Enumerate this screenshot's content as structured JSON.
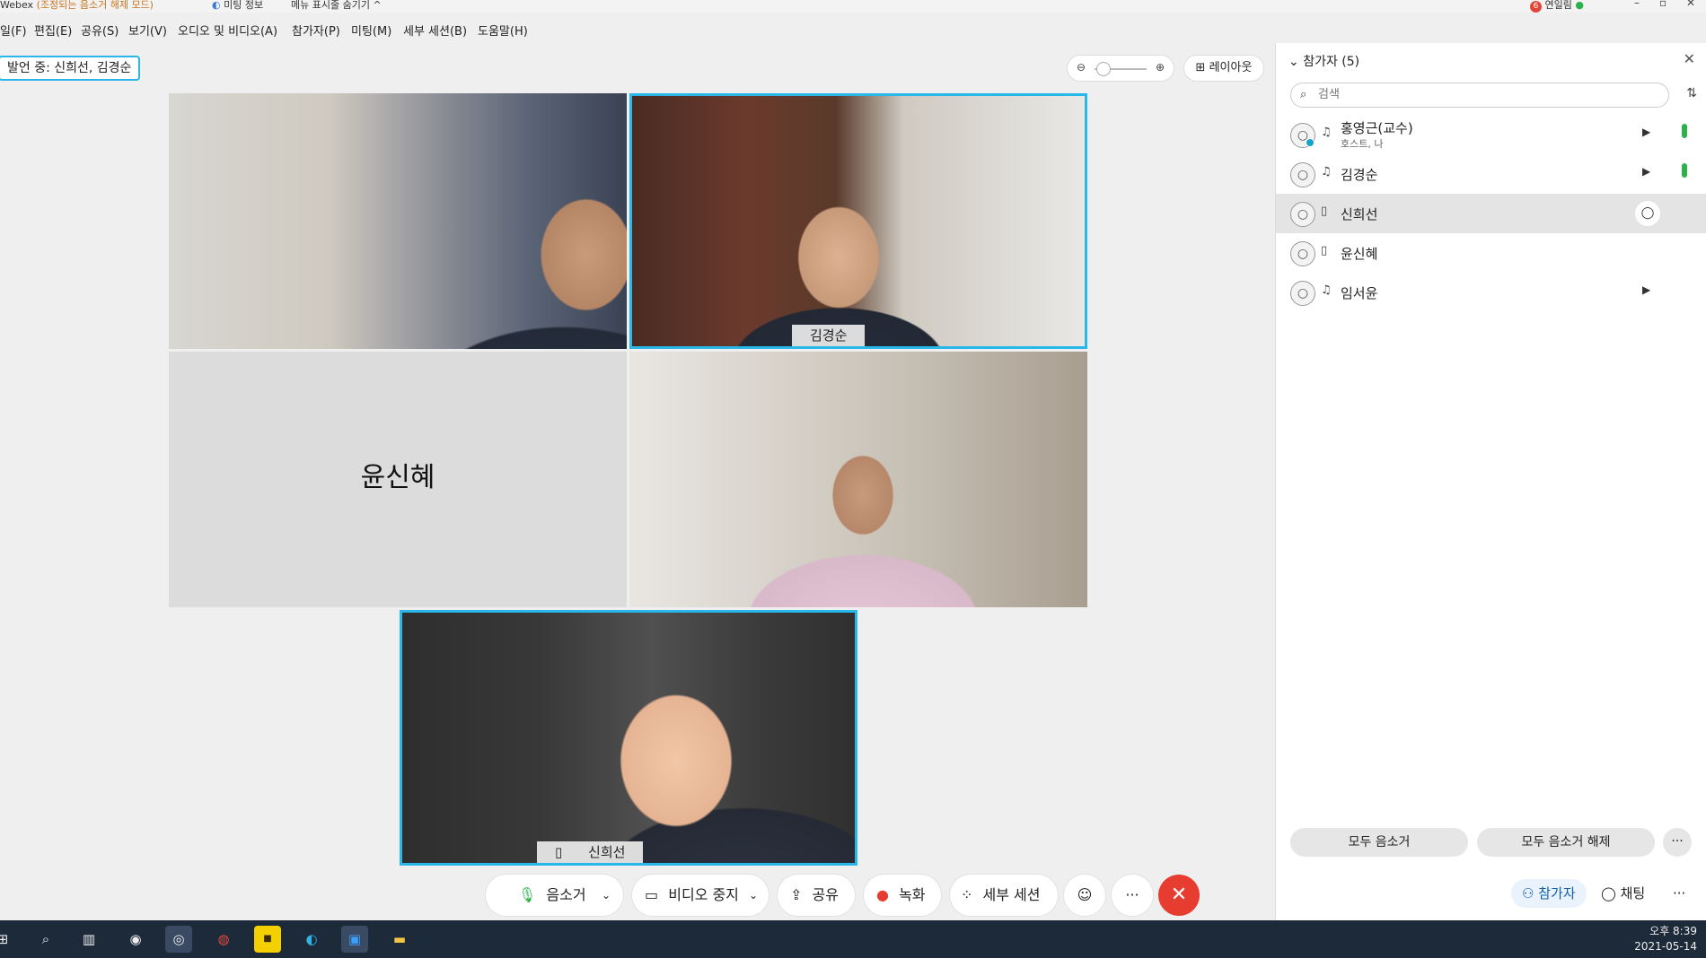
{
  "titlebar": {
    "app": "Webex",
    "mode_notice": "(조정되는 음소거 해제 모드)",
    "meeting_info": "미팅 정보",
    "hide_menu": "메뉴 표시줄 숨기기",
    "hide_menu_icon": "^",
    "user_badge_count": "6",
    "user_name": "연일림"
  },
  "menu": {
    "items": [
      "일(F)",
      "편집(E)",
      "공유(S)",
      "보기(V)",
      "오디오 및 비디오(A)",
      "참가자(P)",
      "미팅(M)",
      "세부 세션(B)",
      "도움말(H)"
    ]
  },
  "stage": {
    "speaking_label": "발언 중: 신희선, 김경순",
    "layout_label": "레이아웃",
    "tiles": [
      {
        "name": ""
      },
      {
        "name": "김경순"
      },
      {
        "name": "윤신혜"
      },
      {
        "name": ""
      },
      {
        "name": "신희선"
      }
    ]
  },
  "toolbar": {
    "mute": "음소거",
    "video": "비디오 중지",
    "share": "공유",
    "record": "녹화",
    "breakout": "세부 세션",
    "more": "···"
  },
  "panel": {
    "title": "참가자 (5)",
    "search_placeholder": "검색",
    "participants": [
      {
        "name": "홍영근(교수)",
        "sub": "호스트, 나"
      },
      {
        "name": "김경순"
      },
      {
        "name": "신희선"
      },
      {
        "name": "윤신혜"
      },
      {
        "name": "임서윤"
      }
    ],
    "mute_all": "모두 음소거",
    "unmute_all": "모두 음소거 해제",
    "more": "···"
  },
  "bottom_right": {
    "participants": "참가자",
    "chat": "채팅",
    "more": "···"
  },
  "taskbar": {
    "time": "오후 8:39",
    "date": "2021-05-14"
  },
  "colors": {
    "active_border": "#29b6e8",
    "end_call": "#e63d30",
    "mic_active": "#2bb34a",
    "taskbar": "#1d2a3a"
  }
}
